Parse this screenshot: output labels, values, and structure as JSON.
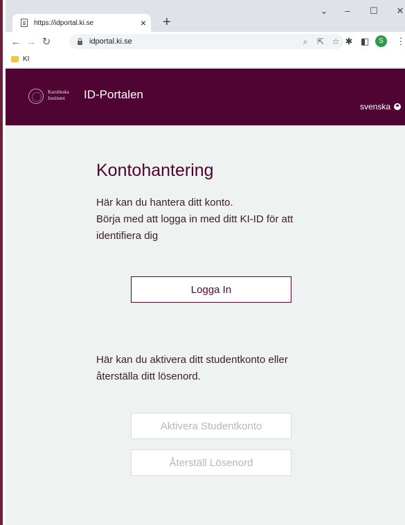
{
  "browser": {
    "tab_title": "https://idportal.ki.se",
    "tab_close": "×",
    "new_tab": "+",
    "url": "idportal.ki.se",
    "bookmark": "KI",
    "profile_initial": "S"
  },
  "site": {
    "logo_line1": "Karolinska",
    "logo_line2": "Institutet",
    "title": "ID-Portalen",
    "language": "svenska"
  },
  "main": {
    "heading": "Kontohantering",
    "intro_line1": "Här kan du hantera ditt konto.",
    "intro_line2": "Börja med att logga in med ditt KI-ID för att identifiera dig",
    "login_button": "Logga In",
    "student_text": "Här kan du aktivera ditt studentkonto eller återställa ditt lösenord.",
    "activate_button": "Aktivera Studentkonto",
    "reset_button": "Återställ Lösenord"
  },
  "colors": {
    "brand": "#4f0433",
    "background": "#eef2f1",
    "disabled_text": "#b8b8b8"
  }
}
